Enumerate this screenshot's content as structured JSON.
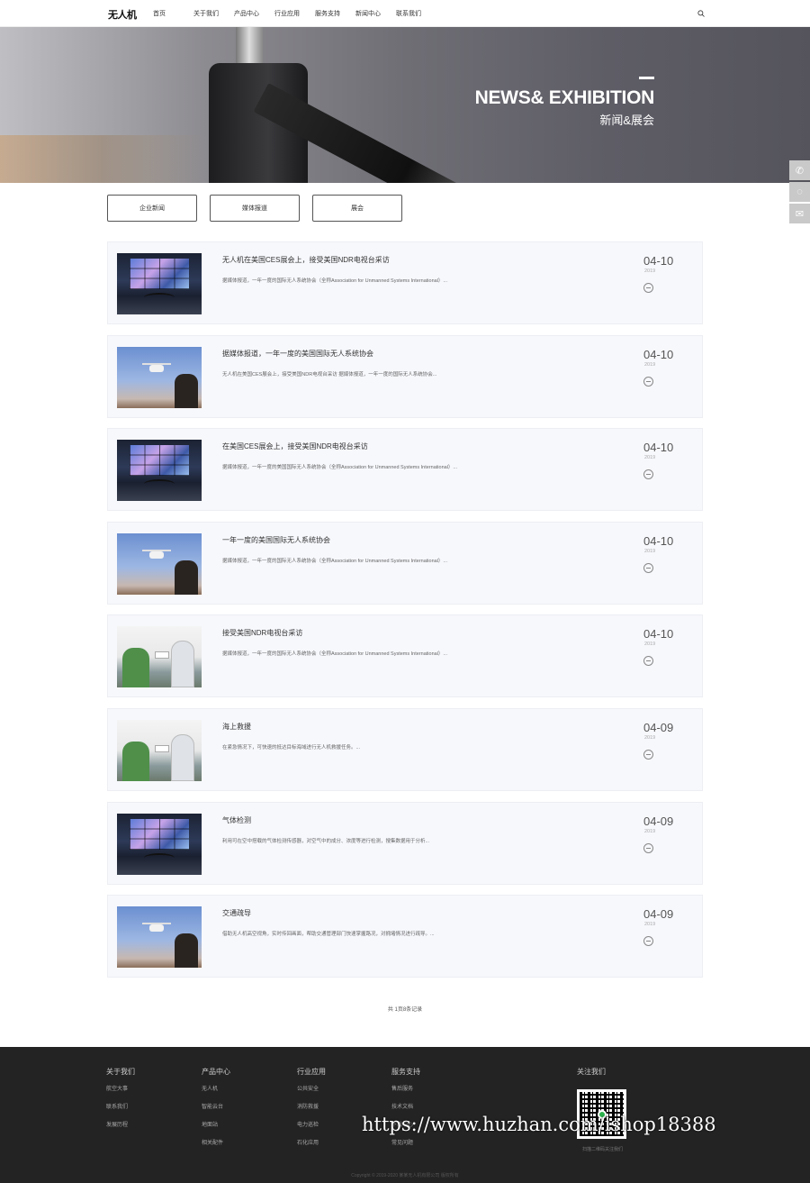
{
  "header": {
    "logo": "无人机",
    "nav": [
      "首页",
      "关于我们",
      "产品中心",
      "行业应用",
      "服务支持",
      "新闻中心",
      "联系我们"
    ]
  },
  "banner": {
    "title": "NEWS& EXHIBITION",
    "subtitle": "新闻&展会"
  },
  "tabs": [
    "企业新闻",
    "媒体报道",
    "展会"
  ],
  "news": [
    {
      "title": "无人机在美国CES展会上，接受美国NDR电视台采访",
      "desc": "据媒体报道，一年一度的国际无人系统协会（全称Association for Unmanned Systems International）...",
      "date": "04-10",
      "year": "2019",
      "thumb": "screens"
    },
    {
      "title": "据媒体报道，一年一度的美国国际无人系统协会",
      "desc": "无人机在美国CES展会上，接受美国NDR电视台采访 据媒体报道，一年一度的国际无人系统协会...",
      "date": "04-10",
      "year": "2019",
      "thumb": "sky"
    },
    {
      "title": "在美国CES展会上，接受美国NDR电视台采访",
      "desc": "据媒体报道，一年一度的美国国际无人系统协会（全称Association for Unmanned Systems International）...",
      "date": "04-10",
      "year": "2019",
      "thumb": "screens"
    },
    {
      "title": "一年一度的美国国际无人系统协会",
      "desc": "据媒体报道，一年一度的国际无人系统协会（全称Association for Unmanned Systems International）...",
      "date": "04-10",
      "year": "2019",
      "thumb": "sky"
    },
    {
      "title": "接受美国NDR电视台采访",
      "desc": "据媒体报道，一年一度的国际无人系统协会（全称Association for Unmanned Systems International）...",
      "date": "04-10",
      "year": "2019",
      "thumb": "people"
    },
    {
      "title": "海上救援",
      "desc": "在紧急情况下，可快速的抵达目标海域进行无人机救援任务。...",
      "date": "04-09",
      "year": "2019",
      "thumb": "people"
    },
    {
      "title": "气体检测",
      "desc": "利用可在空中搭载的气体检测传感器，对空气中的成分、浓度等进行检测，搜集数据用于分析...",
      "date": "04-09",
      "year": "2019",
      "thumb": "screens"
    },
    {
      "title": "交通疏导",
      "desc": "借助无人机高空视角，实时传回画面，帮助交通管理部门快速掌握路况，对拥堵情况进行疏导。...",
      "date": "04-09",
      "year": "2019",
      "thumb": "sky"
    }
  ],
  "pager": "共 1页8条记录",
  "footer": {
    "cols": [
      {
        "title": "关于我们",
        "links": [
          "航空大事",
          "联系我们",
          "发展历程"
        ]
      },
      {
        "title": "产品中心",
        "links": [
          "无人机",
          "智能云台",
          "地面站",
          "相关配件"
        ]
      },
      {
        "title": "行业应用",
        "links": [
          "公共安全",
          "消防救援",
          "电力巡检",
          "石化应用"
        ]
      },
      {
        "title": "服务支持",
        "links": [
          "售后服务",
          "技术文档",
          "下载中心",
          "常见问题"
        ]
      }
    ],
    "follow_title": "关注我们",
    "qr_caption": "扫描二维码关注我们",
    "copyright": "Copyright © 2019-2020 某某无人机有限公司 版权所有"
  },
  "watermark": "https://www.huzhan.com/ishop18388",
  "colors": {
    "footer_bg": "#232323",
    "card_bg": "#f7f8fc"
  }
}
